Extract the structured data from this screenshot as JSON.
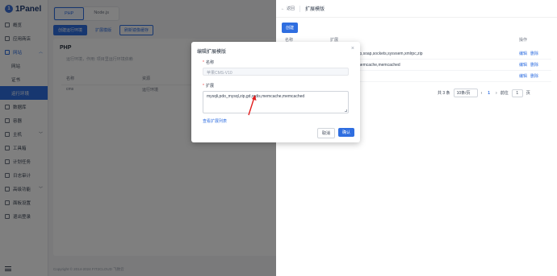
{
  "app": {
    "logo_text": "1Panel"
  },
  "sidebar": {
    "items": [
      {
        "label": "概览",
        "icon": "dashboard-icon"
      },
      {
        "label": "应用商店",
        "icon": "appstore-icon"
      },
      {
        "label": "网站",
        "icon": "globe-icon"
      },
      {
        "label": "网站",
        "icon": ""
      },
      {
        "label": "证书",
        "icon": ""
      },
      {
        "label": "运行环境",
        "icon": ""
      },
      {
        "label": "数据库",
        "icon": "database-icon"
      },
      {
        "label": "容器",
        "icon": "container-icon"
      },
      {
        "label": "主机",
        "icon": "host-icon"
      },
      {
        "label": "工具箱",
        "icon": "toolbox-icon"
      },
      {
        "label": "计划任务",
        "icon": "cron-icon"
      },
      {
        "label": "日志审计",
        "icon": "log-icon"
      },
      {
        "label": "高级功能",
        "icon": "advanced-icon"
      },
      {
        "label": "面板设置",
        "icon": "settings-icon"
      },
      {
        "label": "退出登录",
        "icon": "logout-icon"
      }
    ]
  },
  "main": {
    "tabs": [
      {
        "label": "PHP"
      },
      {
        "label": "Node.js"
      }
    ],
    "toolbar": {
      "create": "创建运行环境",
      "ext_template": "扩展模版",
      "sync": "刷新镜像缓存"
    },
    "card": {
      "title": "PHP",
      "desc": "运行环境，作用: 项目里运行环境依赖"
    },
    "table": {
      "headers": [
        "名称",
        "资源"
      ],
      "row": [
        "cms",
        "运行环境"
      ]
    },
    "copyright": "Copyright © 2014-2024 FIT2CLOUD 飞致云"
  },
  "drawer": {
    "back": "返回",
    "title": "扩展模版",
    "create": "创建",
    "headers": [
      "名称",
      "扩展",
      "操作"
    ],
    "rows": [
      {
        "name": "",
        "ext": "...ext,pcntl,shmop,soap,sockets,sysvsem,xmlrpc,zip"
      },
      {
        "name": "",
        "ext": "...l,zip,gd,redis,memcache,memcached"
      },
      {
        "name": "",
        "ext": "...zip,gd,curl"
      }
    ],
    "row_actions": {
      "edit": "编辑",
      "delete": "删除"
    },
    "pager": {
      "total": "共 3 条",
      "page_size": "10条/页",
      "current": "1",
      "goto": "前往",
      "goto_value": "1",
      "page_suffix": "页"
    }
  },
  "dialog": {
    "title": "编辑扩展模版",
    "name_label": "名称",
    "name_value": "苹果CMS-V10",
    "ext_label": "扩展",
    "ext_value": "mysqli,pdo_mysql,zip,gd,redis,memcache,memcached",
    "view_link": "查看扩展列表",
    "cancel": "取消",
    "ok": "确认"
  }
}
